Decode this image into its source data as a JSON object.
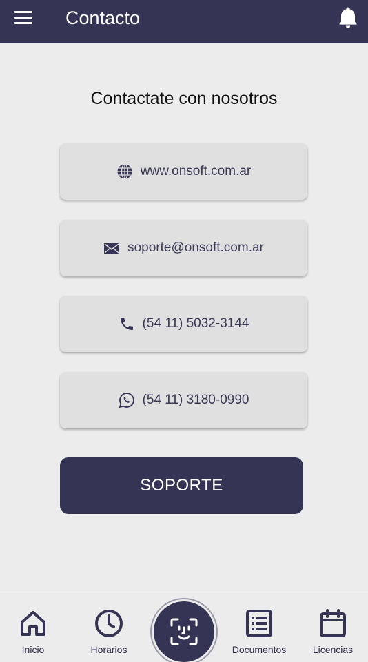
{
  "header": {
    "title": "Contacto"
  },
  "main": {
    "heading": "Contactate con nosotros",
    "contacts": [
      {
        "icon": "globe-icon",
        "label": "www.onsoft.com.ar"
      },
      {
        "icon": "mail-icon",
        "label": "soporte@onsoft.com.ar"
      },
      {
        "icon": "phone-icon",
        "label": "(54 11) 5032-3144"
      },
      {
        "icon": "whatsapp-icon",
        "label": "(54 11) 3180-0990"
      }
    ],
    "support_button": "SOPORTE"
  },
  "bottom_nav": {
    "items": [
      {
        "icon": "home-icon",
        "label": "Inicio"
      },
      {
        "icon": "clock-icon",
        "label": "Horarios"
      },
      {
        "icon": "face-scan-icon",
        "label": ""
      },
      {
        "icon": "list-icon",
        "label": "Documentos"
      },
      {
        "icon": "calendar-icon",
        "label": "Licencias"
      }
    ]
  },
  "colors": {
    "primary": "#363454",
    "background": "#ececec",
    "card": "#e0e0e0"
  }
}
